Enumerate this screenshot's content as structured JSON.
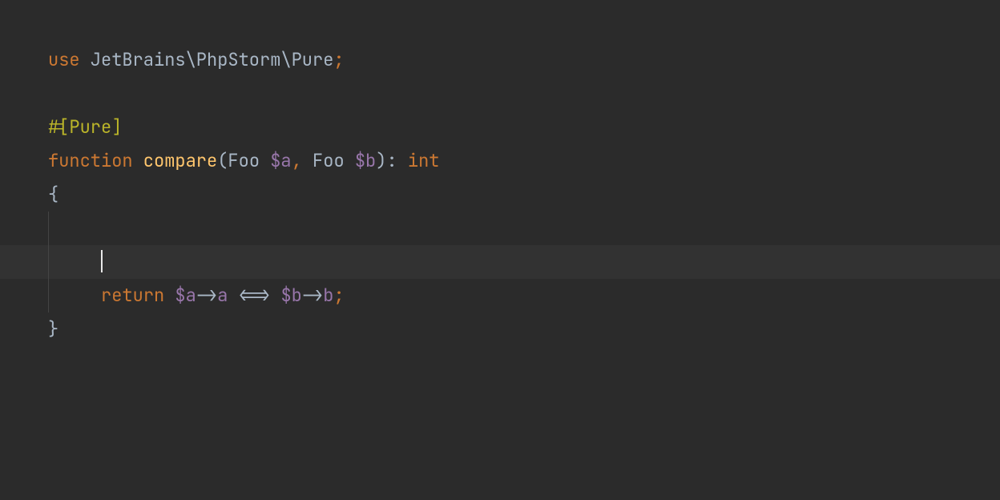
{
  "code": {
    "use_kw": "use",
    "namespace": " JetBrains\\PhpStorm\\Pure",
    "semi": ";",
    "attribute": "#[Pure]",
    "function_kw": "function",
    "function_name": " compare",
    "paren_open": "(",
    "param1_type": "Foo ",
    "param1_var": "$a",
    "comma": ",",
    "param2_type": " Foo ",
    "param2_var": "$b",
    "paren_close": ")",
    "colon_ret": ": ",
    "return_type": "int",
    "brace_open": "{",
    "brace_close": "}",
    "return_kw": "return",
    "return_sp": " ",
    "ret_var_a": "$a",
    "arrow1": "->",
    "prop_a": "a",
    "spaceship": " <=> ",
    "ret_var_b": "$b",
    "arrow2": "->",
    "prop_b": "b",
    "indent1": "    ",
    "indent2": "     "
  }
}
